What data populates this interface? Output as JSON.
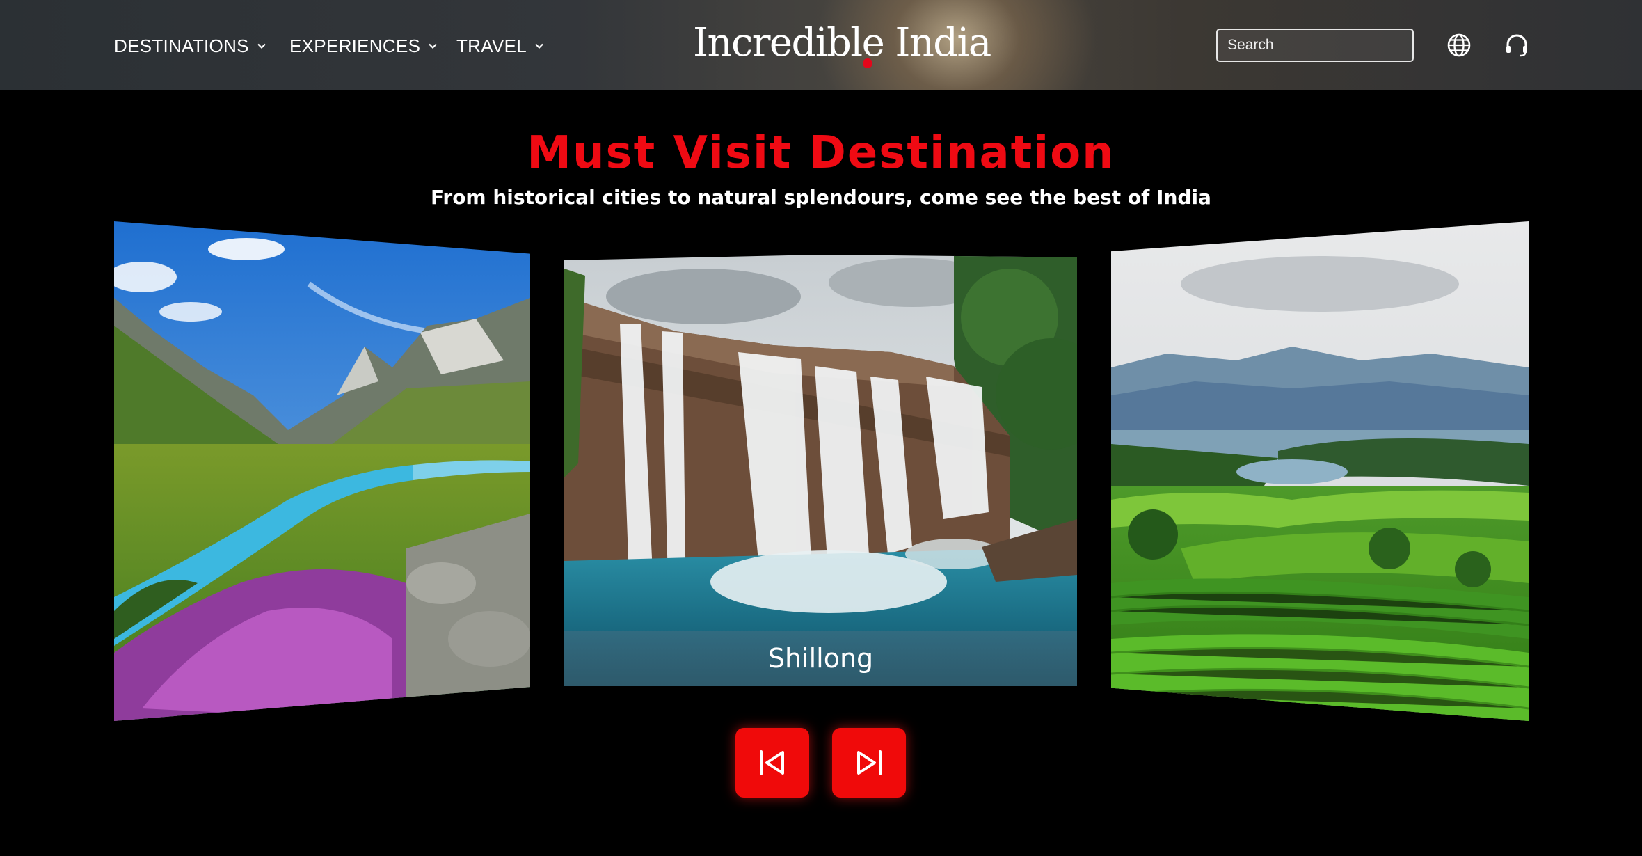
{
  "header": {
    "nav": [
      {
        "label": "DESTINATIONS"
      },
      {
        "label": "EXPERIENCES"
      },
      {
        "label": "TRAVEL"
      }
    ],
    "logo_text": "Incredible India",
    "search_placeholder": "Search",
    "icons": [
      "chevron-down-icon",
      "search-icon",
      "globe-icon",
      "headset-icon"
    ]
  },
  "section": {
    "title": "Must Visit Destination",
    "subtitle": "From historical cities to natural splendours, come see the best of India"
  },
  "carousel": {
    "cards": [
      {
        "scene": "alpine-meadow"
      },
      {
        "scene": "waterfall",
        "caption": "Shillong"
      },
      {
        "scene": "tea-hills"
      }
    ],
    "controls": [
      "skip-previous-icon",
      "skip-next-icon"
    ]
  },
  "colors": {
    "accent": "#ef0a13",
    "button": "#f00a0a",
    "background": "#000000"
  }
}
